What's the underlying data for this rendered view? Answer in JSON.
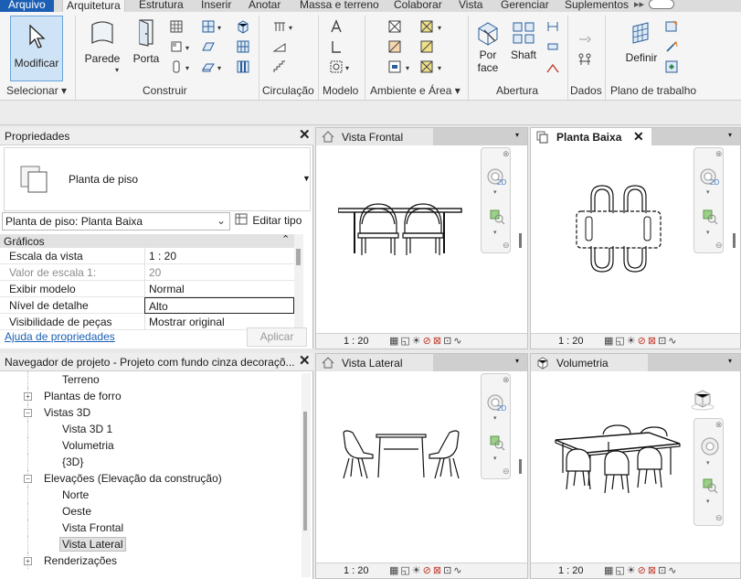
{
  "ribbon": {
    "tabs": [
      "Arquivo",
      "Arquitetura",
      "Estrutura",
      "Inserir",
      "Anotar",
      "Massa e terreno",
      "Colaborar",
      "Vista",
      "Gerenciar",
      "Suplementos"
    ],
    "buttons": {
      "modificar": "Modificar",
      "parede": "Parede",
      "porta": "Porta",
      "por_face": "Por face",
      "shaft": "Shaft",
      "definir": "Definir"
    },
    "panels": {
      "selecionar": "Selecionar",
      "construir": "Construir",
      "circulacao": "Circulação",
      "modelo": "Modelo",
      "ambiente_area": "Ambiente e Área",
      "abertura": "Abertura",
      "dados": "Dados",
      "plano_trabalho": "Plano de trabalho"
    }
  },
  "properties": {
    "title": "Propriedades",
    "type_name": "Planta de piso",
    "instance_selector": "Planta de piso: Planta Baixa",
    "edit_type": "Editar tipo",
    "section": "Gráficos",
    "rows": [
      {
        "key": "Escala da vista",
        "value": "1 : 20",
        "disabled": false
      },
      {
        "key": "Valor de escala    1:",
        "value": "20",
        "disabled": true
      },
      {
        "key": "Exibir modelo",
        "value": "Normal",
        "disabled": false
      },
      {
        "key": "Nível de detalhe",
        "value": "Alto",
        "disabled": false
      },
      {
        "key": "Visibilidade de peças",
        "value": "Mostrar original",
        "disabled": false
      }
    ],
    "help_link": "Ajuda de propriedades",
    "apply": "Aplicar"
  },
  "browser": {
    "title": "Navegador de projeto - Projeto com fundo cinza decoraçõ...",
    "nodes": [
      {
        "label": "Terreno",
        "level": 2,
        "expander": ""
      },
      {
        "label": "Plantas de forro",
        "level": 1,
        "expander": "+"
      },
      {
        "label": "Vistas 3D",
        "level": 1,
        "expander": "−"
      },
      {
        "label": "Vista 3D 1",
        "level": 2,
        "expander": ""
      },
      {
        "label": "Volumetria",
        "level": 2,
        "expander": ""
      },
      {
        "label": "{3D}",
        "level": 2,
        "expander": ""
      },
      {
        "label": "Elevações (Elevação da construção)",
        "level": 1,
        "expander": "−"
      },
      {
        "label": "Norte",
        "level": 2,
        "expander": ""
      },
      {
        "label": "Oeste",
        "level": 2,
        "expander": ""
      },
      {
        "label": "Vista Frontal",
        "level": 2,
        "expander": ""
      },
      {
        "label": "Vista Lateral",
        "level": 2,
        "expander": "",
        "selected": true
      },
      {
        "label": "Renderizações",
        "level": 1,
        "expander": "+"
      }
    ]
  },
  "views": {
    "frontal": {
      "title": "Vista Frontal",
      "scale": "1 : 20"
    },
    "planta": {
      "title": "Planta Baixa",
      "scale": "1 : 20"
    },
    "lateral": {
      "title": "Vista Lateral",
      "scale": "1 : 20"
    },
    "volumetria": {
      "title": "Volumetria",
      "scale": "1 : 20"
    }
  },
  "colors": {
    "accent": "#1b5fb4",
    "selection": "#cfe3f6"
  }
}
